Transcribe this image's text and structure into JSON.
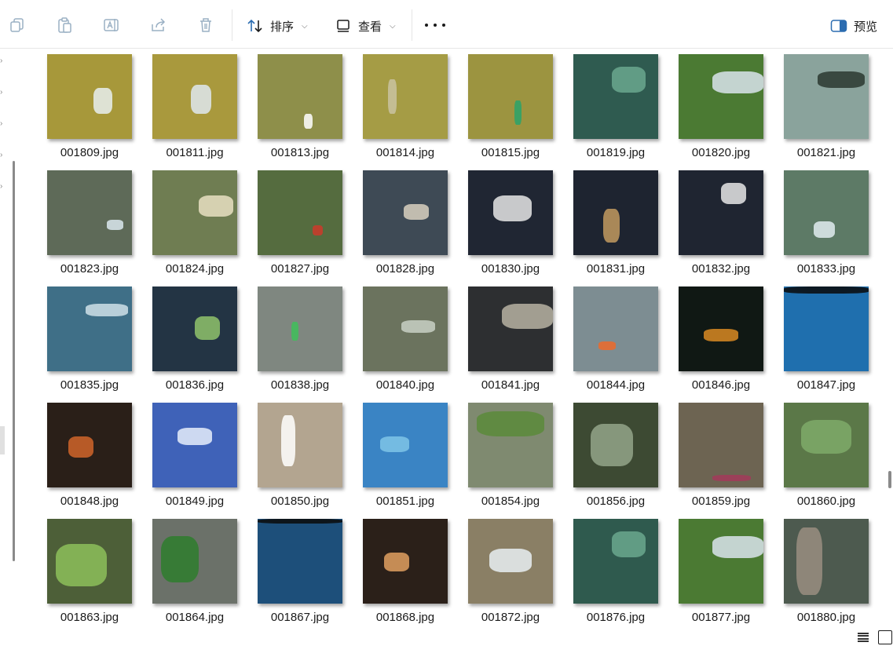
{
  "toolbar": {
    "sort_label": "排序",
    "view_label": "查看",
    "preview_label": "预览"
  },
  "icons": {
    "copy": "copy-icon",
    "paste": "paste-icon",
    "rename": "rename-icon",
    "share": "share-icon",
    "delete": "delete-icon",
    "sort": "sort-icon",
    "view": "view-icon",
    "more": "more-icon",
    "preview": "preview-pane-icon"
  },
  "files": [
    {
      "name": "001809.jpg",
      "bg": "#a7983a"
    },
    {
      "name": "001811.jpg",
      "bg": "#a9993d"
    },
    {
      "name": "001813.jpg",
      "bg": "#8e8f4a"
    },
    {
      "name": "001814.jpg",
      "bg": "#a59c45"
    },
    {
      "name": "001815.jpg",
      "bg": "#9c9440"
    },
    {
      "name": "001819.jpg",
      "bg": "#2f5b50"
    },
    {
      "name": "001820.jpg",
      "bg": "#4b7a33"
    },
    {
      "name": "001821.jpg",
      "bg": "#8aa39c"
    },
    {
      "name": "001823.jpg",
      "bg": "#5e6a58"
    },
    {
      "name": "001824.jpg",
      "bg": "#6f7d52"
    },
    {
      "name": "001827.jpg",
      "bg": "#556c3f"
    },
    {
      "name": "001828.jpg",
      "bg": "#3e4a55"
    },
    {
      "name": "001830.jpg",
      "bg": "#202633"
    },
    {
      "name": "001831.jpg",
      "bg": "#1e2430"
    },
    {
      "name": "001832.jpg",
      "bg": "#1f2531"
    },
    {
      "name": "001833.jpg",
      "bg": "#5d7a66"
    },
    {
      "name": "001835.jpg",
      "bg": "#3f6f87"
    },
    {
      "name": "001836.jpg",
      "bg": "#233444"
    },
    {
      "name": "001838.jpg",
      "bg": "#7f8780"
    },
    {
      "name": "001840.jpg",
      "bg": "#6b735e"
    },
    {
      "name": "001841.jpg",
      "bg": "#2d2f31"
    },
    {
      "name": "001844.jpg",
      "bg": "#7d8d92"
    },
    {
      "name": "001846.jpg",
      "bg": "#101814"
    },
    {
      "name": "001847.jpg",
      "bg": "#1f6fae"
    },
    {
      "name": "001848.jpg",
      "bg": "#2a1f18"
    },
    {
      "name": "001849.jpg",
      "bg": "#3f62b8"
    },
    {
      "name": "001850.jpg",
      "bg": "#b3a590"
    },
    {
      "name": "001851.jpg",
      "bg": "#3a84c4"
    },
    {
      "name": "001854.jpg",
      "bg": "#7f8a70"
    },
    {
      "name": "001856.jpg",
      "bg": "#3d4a33"
    },
    {
      "name": "001859.jpg",
      "bg": "#6d6452"
    },
    {
      "name": "001860.jpg",
      "bg": "#5b7848"
    },
    {
      "name": "001863.jpg",
      "bg": "#4d5f38"
    },
    {
      "name": "001864.jpg",
      "bg": "#6b7169"
    },
    {
      "name": "001867.jpg",
      "bg": "#1d4f7a"
    },
    {
      "name": "001868.jpg",
      "bg": "#2b2019"
    },
    {
      "name": "001872.jpg",
      "bg": "#8a7f65"
    },
    {
      "name": "001876.jpg",
      "bg": "#2f5a4e"
    },
    {
      "name": "001877.jpg",
      "bg": "#4b7a33"
    },
    {
      "name": "001880.jpg",
      "bg": "#4d5a4f"
    }
  ]
}
